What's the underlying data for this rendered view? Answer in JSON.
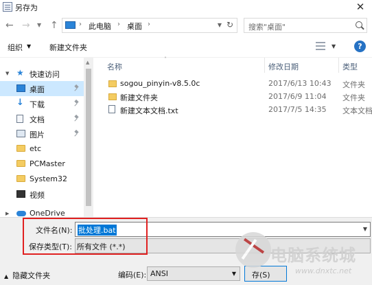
{
  "window": {
    "title": "另存为",
    "close_glyph": "✕"
  },
  "address": {
    "crumbs": [
      "此电脑",
      "桌面"
    ],
    "separator": "›",
    "search_placeholder": "搜索\"桌面\""
  },
  "toolbar": {
    "organize_label": "组织",
    "new_folder_label": "新建文件夹",
    "help_glyph": "?"
  },
  "nav_pane": {
    "items": [
      {
        "label": "快速访问",
        "icon": "star-icon",
        "pinned": false
      },
      {
        "label": "桌面",
        "icon": "desktop-icon",
        "pinned": true,
        "selected": true
      },
      {
        "label": "下载",
        "icon": "download-icon",
        "pinned": true
      },
      {
        "label": "文档",
        "icon": "document-icon",
        "pinned": true
      },
      {
        "label": "图片",
        "icon": "picture-icon",
        "pinned": true
      },
      {
        "label": "etc",
        "icon": "folder-icon",
        "pinned": false
      },
      {
        "label": "PCMaster",
        "icon": "folder-icon",
        "pinned": false
      },
      {
        "label": "System32",
        "icon": "folder-icon",
        "pinned": false
      },
      {
        "label": "视频",
        "icon": "video-icon",
        "pinned": false
      },
      {
        "label": "OneDrive",
        "icon": "cloud-icon",
        "pinned": false
      }
    ]
  },
  "file_list": {
    "columns": {
      "name": "名称",
      "date": "修改日期",
      "type": "类型"
    },
    "rows": [
      {
        "name": "sogou_pinyin-v8.5.0c",
        "date": "2017/6/13 10:43",
        "type": "文件夹",
        "icon": "folder-icon"
      },
      {
        "name": "新建文件夹",
        "date": "2017/6/9 11:04",
        "type": "文件夹",
        "icon": "folder-icon"
      },
      {
        "name": "新建文本文档.txt",
        "date": "2017/7/5 14:35",
        "type": "文本文档",
        "icon": "text-file-icon"
      }
    ]
  },
  "form": {
    "filename_label": "文件名(N):",
    "filename_value": "批处理.bat",
    "savetype_label": "保存类型(T):",
    "savetype_value": "所有文件  (*.*)",
    "hide_folders_label": "隐藏文件夹",
    "encoding_label": "编码(E):",
    "encoding_value": "ANSI",
    "save_button_label": "存(S)"
  },
  "watermark": {
    "text": "电脑系统城",
    "url": "www.dnxtc.net"
  },
  "colors": {
    "accent": "#0078d7",
    "selection": "#cce8ff",
    "highlight_box": "#e02020",
    "folder": "#f4cc62"
  }
}
